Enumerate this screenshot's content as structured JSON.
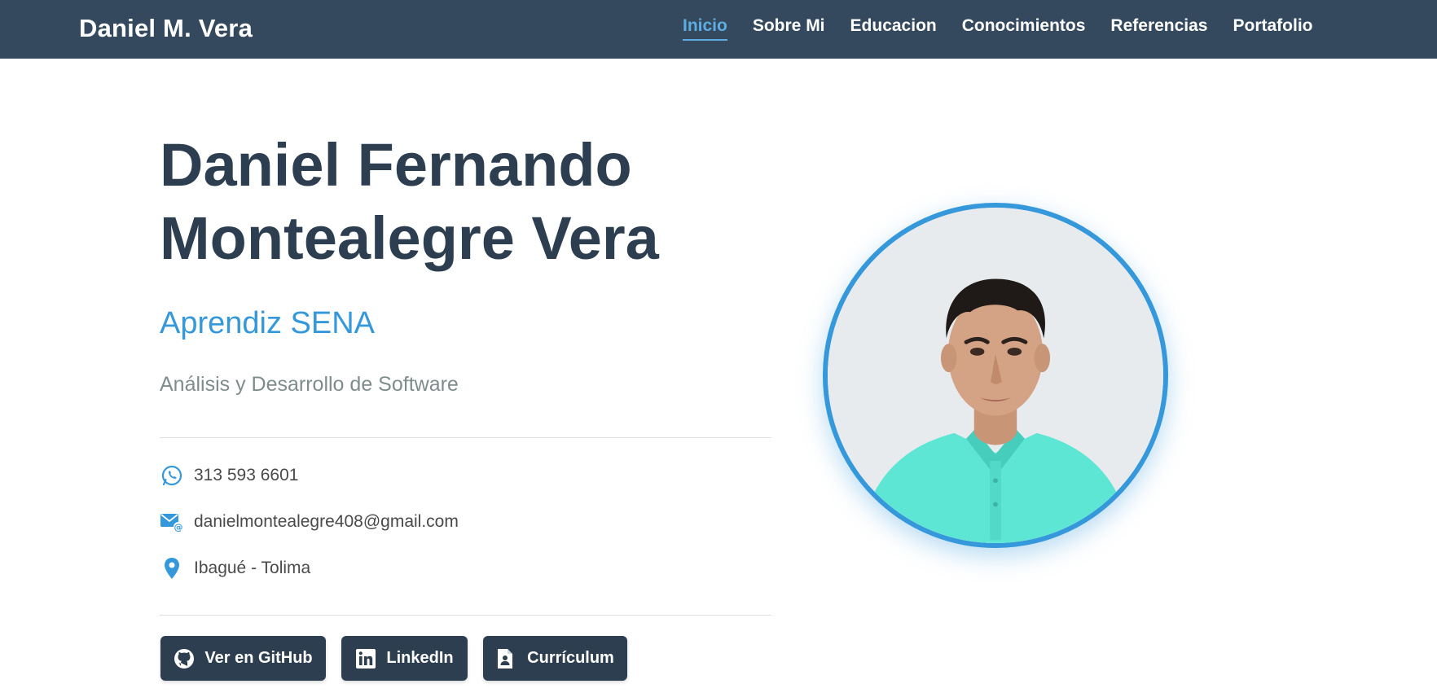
{
  "navbar": {
    "brand": "Daniel M. Vera",
    "links": [
      {
        "label": "Inicio",
        "active": true
      },
      {
        "label": "Sobre Mi",
        "active": false
      },
      {
        "label": "Educacion",
        "active": false
      },
      {
        "label": "Conocimientos",
        "active": false
      },
      {
        "label": "Referencias",
        "active": false
      },
      {
        "label": "Portafolio",
        "active": false
      }
    ]
  },
  "hero": {
    "name_line1": "Daniel Fernando",
    "name_line2": "Montealegre Vera",
    "role": "Aprendiz SENA",
    "program": "Análisis y Desarrollo de Software"
  },
  "contact": {
    "phone": {
      "icon": "whatsapp-icon",
      "text": "313 593 6601"
    },
    "email": {
      "icon": "email-icon",
      "text": "danielmontealegre408@gmail.com"
    },
    "location": {
      "icon": "location-pin-icon",
      "text": "Ibagué - Tolima"
    }
  },
  "buttons": {
    "github": {
      "icon": "github-icon",
      "label": "Ver en GitHub"
    },
    "linkedin": {
      "icon": "linkedin-icon",
      "label": "LinkedIn"
    },
    "cv": {
      "icon": "document-icon",
      "label": "Currículum"
    }
  },
  "colors": {
    "navbar_bg": "#34495e",
    "accent": "#3498db",
    "heading": "#2c3e50",
    "muted": "#7f8c8d",
    "button_bg": "#2c3e50"
  }
}
